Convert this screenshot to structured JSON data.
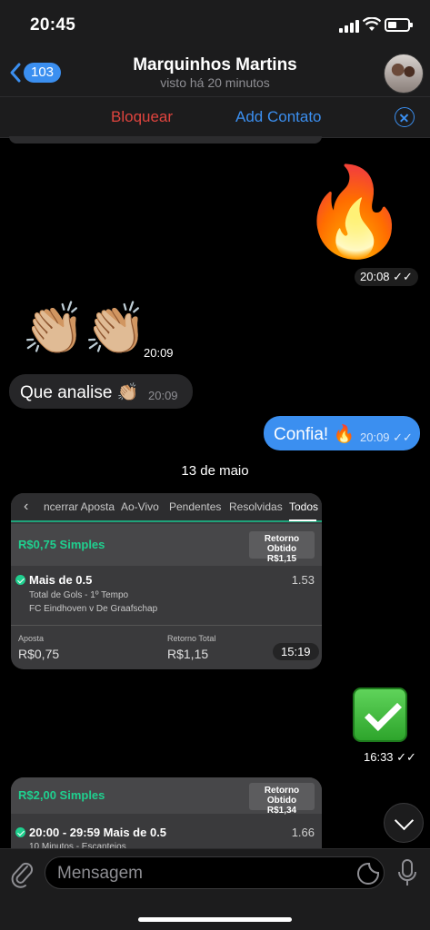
{
  "status_bar": {
    "time": "20:45"
  },
  "header": {
    "back_count": "103",
    "name": "Marquinhos Martins",
    "status": "visto há 20 minutos"
  },
  "actions": {
    "block": "Bloquear",
    "add_contact": "Add Contato"
  },
  "messages": {
    "fire": {
      "emoji": "🔥",
      "time": "20:08"
    },
    "claps": {
      "emoji": "👏🏼",
      "time": "20:09"
    },
    "que_analise": {
      "text": "Que analise 👏🏼",
      "time": "20:09"
    },
    "confia": {
      "text": "Confia! 🔥",
      "time": "20:09"
    },
    "date": "13 de maio",
    "bet_card": {
      "tabs": [
        "‹",
        "ncerrar Aposta",
        "Ao-Vivo",
        "Pendentes",
        "Resolvidas",
        "Todos"
      ],
      "amount": "R$0,75 Simples",
      "retorno_label": "Retorno Obtido",
      "retorno_value": "R$1,15",
      "selection": "Mais de 0.5",
      "odds": "1.53",
      "market": "Total de Gols - 1º Tempo",
      "event": "FC Eindhoven v De Graafschap",
      "aposta_label": "Aposta",
      "aposta_value": "R$0,75",
      "retorno_total_label": "Retorno Total",
      "retorno_total_value": "R$1,15",
      "time": "15:19"
    },
    "check": {
      "time": "16:33"
    },
    "bet_card2": {
      "amount": "R$2,00 Simples",
      "retorno_label": "Retorno Obtido",
      "retorno_value": "R$1,34",
      "selection": "20:00 - 29:59 Mais de 0.5",
      "odds": "1.66",
      "market": "10 Minutos - Escanteios"
    }
  },
  "input": {
    "placeholder": "Mensagem"
  },
  "colors": {
    "accent": "#3b8ff0",
    "danger": "#e0443e",
    "bet_green": "#1fd08f"
  }
}
